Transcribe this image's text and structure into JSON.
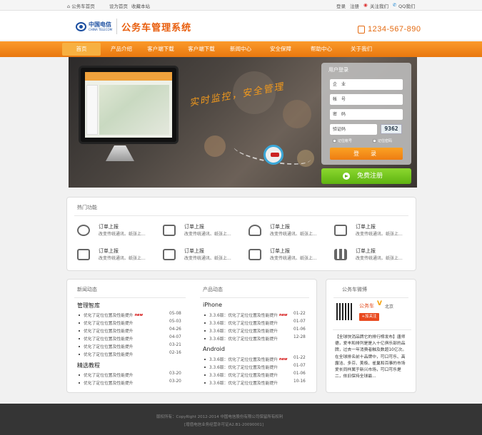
{
  "topbar": {
    "home": "公务车首页",
    "set_home": "设为首页",
    "bookmark": "收藏本站",
    "login": "登录",
    "register": "注册",
    "follow_us": "关注我们",
    "qq": "QQ我们"
  },
  "header": {
    "brand_cn": "中国电信",
    "brand_en": "CHINA TELECOM",
    "system_title": "公务车管理系统",
    "phone": "1234-567-890"
  },
  "nav": [
    "首页",
    "产品介绍",
    "客户端下载",
    "客户端下载",
    "新闻中心",
    "安全保障",
    "帮助中心",
    "关于我们"
  ],
  "banner": {
    "slogan": "实时监控，安全管理"
  },
  "login": {
    "title": "用户登录",
    "company_placeholder": "企　业",
    "account_placeholder": "帐　号",
    "password_placeholder": "密　码",
    "captcha_placeholder": "验证码",
    "captcha_code": "9362",
    "remember_account": "记住帐号",
    "remember_password": "记住密码",
    "submit": "登　录",
    "register": "免费注册"
  },
  "hot": {
    "title": "热门功能",
    "items": [
      {
        "title": "订单上报",
        "desc": "改变传统通讯、纸张上...",
        "icon": "clock-icon"
      },
      {
        "title": "订单上报",
        "desc": "改变传统通讯、纸张上...",
        "icon": "camera-icon"
      },
      {
        "title": "订单上报",
        "desc": "改变传统通讯、纸张上...",
        "icon": "users-icon"
      },
      {
        "title": "订单上报",
        "desc": "改变传统通讯、纸张上...",
        "icon": "map-icon"
      },
      {
        "title": "订单上报",
        "desc": "改变传统通讯、纸张上...",
        "icon": "flag-icon"
      },
      {
        "title": "订单上报",
        "desc": "改变传统通讯、纸张上...",
        "icon": "list-icon"
      },
      {
        "title": "订单上报",
        "desc": "改变传统通讯、纸张上...",
        "icon": "box-icon"
      },
      {
        "title": "订单上报",
        "desc": "改变传统通讯、纸张上...",
        "icon": "bar-chart-icon"
      }
    ]
  },
  "news": {
    "title": "新闻动态",
    "sections": [
      {
        "heading": "管理智库",
        "items": [
          {
            "text": "优化了定位位置及性能提升",
            "date": "05-08",
            "hot": true
          },
          {
            "text": "优化了定位位置及性能提升",
            "date": "05-03",
            "hot": false
          },
          {
            "text": "优化了定位位置及性能提升",
            "date": "04-26",
            "hot": false
          },
          {
            "text": "优化了定位位置及性能提升",
            "date": "04-07",
            "hot": false
          },
          {
            "text": "优化了定位位置及性能提升",
            "date": "03-21",
            "hot": false
          },
          {
            "text": "优化了定位位置及性能提升",
            "date": "02-16",
            "hot": false
          }
        ]
      },
      {
        "heading": "精选教程",
        "items": [
          {
            "text": "优化了定位位置及性能提升",
            "date": "03-20",
            "hot": false
          },
          {
            "text": "优化了定位位置及性能提升",
            "date": "03-20",
            "hot": false
          }
        ]
      }
    ]
  },
  "product": {
    "title": "产品动态",
    "sections": [
      {
        "heading": "iPhone",
        "items": [
          {
            "text": "3.3.6版：优化了定位位置及性能提升",
            "date": "01-22",
            "hot": true
          },
          {
            "text": "3.3.6版：优化了定位位置及性能提升",
            "date": "01-07",
            "hot": false
          },
          {
            "text": "3.3.6版：优化了定位位置及性能提升",
            "date": "01-06",
            "hot": false
          },
          {
            "text": "3.3.6版：优化了定位位置及性能提升",
            "date": "12-28",
            "hot": false
          }
        ]
      },
      {
        "heading": "Android",
        "items": [
          {
            "text": "3.3.6版：优化了定位位置及性能提升",
            "date": "01-22",
            "hot": true
          },
          {
            "text": "3.3.6版：优化了定位位置及性能提升",
            "date": "01-07",
            "hot": false
          },
          {
            "text": "3.3.6版：优化了定位位置及性能提升",
            "date": "01-06",
            "hot": false
          },
          {
            "text": "3.3.6版：优化了定位位置及性能提升",
            "date": "10-16",
            "hot": false
          }
        ]
      }
    ]
  },
  "weibo": {
    "title": "公务车微博",
    "name": "公务车",
    "verified": "V",
    "location": "北京",
    "follow": "+加关注",
    "text": "【全球快消品牌它的排行榜发布】唐师德，爱丰和排列是是入十亿俱乐部的品牌，过去一年消费者触及数超10亿次。在全球排名前十品牌中，可口可乐、高露洁、多芬、美极、雀巢和百事的市场爱长同样属于新兴市场，可口可乐是二，依旧保持全球最..."
  },
  "footer": {
    "copyright": "版权所有：CopyRight 2012-2014 中国电信股份有限公司保留所有权利",
    "icp": "[增值电信业务经营许可证A2.B1-20090001]"
  },
  "hot_label": "new"
}
